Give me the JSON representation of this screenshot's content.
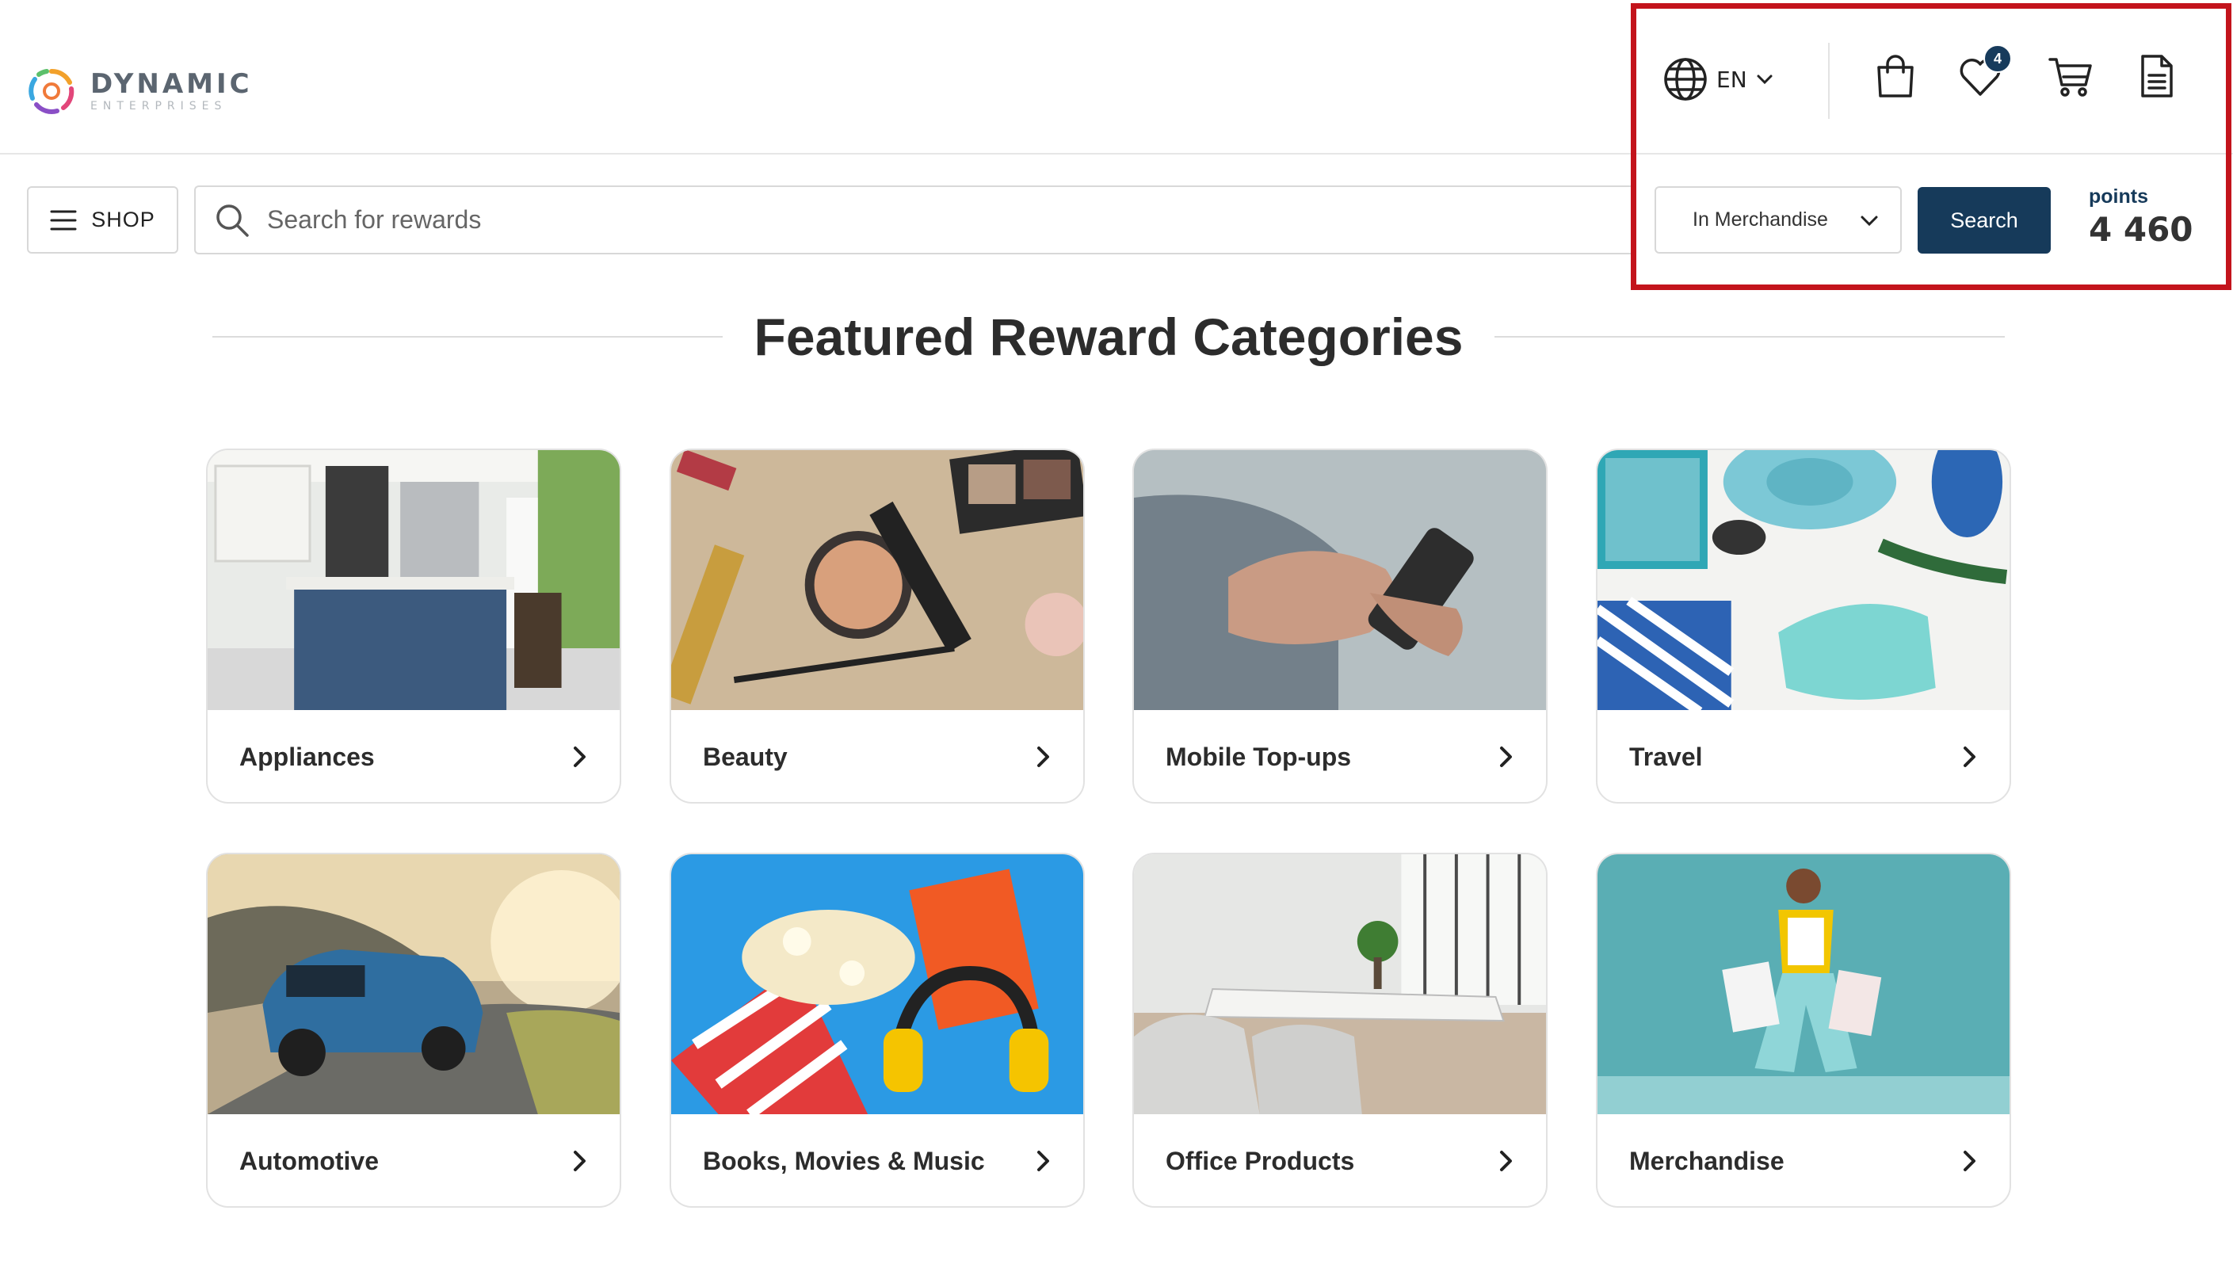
{
  "header": {
    "logo": {
      "title": "DYNAMIC",
      "subtitle": "ENTERPRISES"
    },
    "language": {
      "label": "EN",
      "icon": "globe-icon"
    },
    "icons": [
      {
        "name": "shopping-bag-icon"
      },
      {
        "name": "wishlist-heart-icon",
        "badge": "4"
      },
      {
        "name": "cart-icon"
      },
      {
        "name": "orders-document-icon"
      }
    ]
  },
  "search": {
    "shop_label": "SHOP",
    "placeholder": "Search for rewards",
    "value": "",
    "scope": "In Merchandise",
    "button_label": "Search"
  },
  "points": {
    "label": "points",
    "value": "4 460"
  },
  "section": {
    "title": "Featured Reward Categories"
  },
  "categories": [
    {
      "label": "Appliances"
    },
    {
      "label": "Beauty"
    },
    {
      "label": "Mobile Top-ups"
    },
    {
      "label": "Travel"
    },
    {
      "label": "Automotive"
    },
    {
      "label": "Books, Movies & Music"
    },
    {
      "label": "Office Products"
    },
    {
      "label": "Merchandise"
    }
  ],
  "colors": {
    "primary": "#163a5a",
    "highlight": "#c3141c",
    "badge": "#173b5c"
  }
}
